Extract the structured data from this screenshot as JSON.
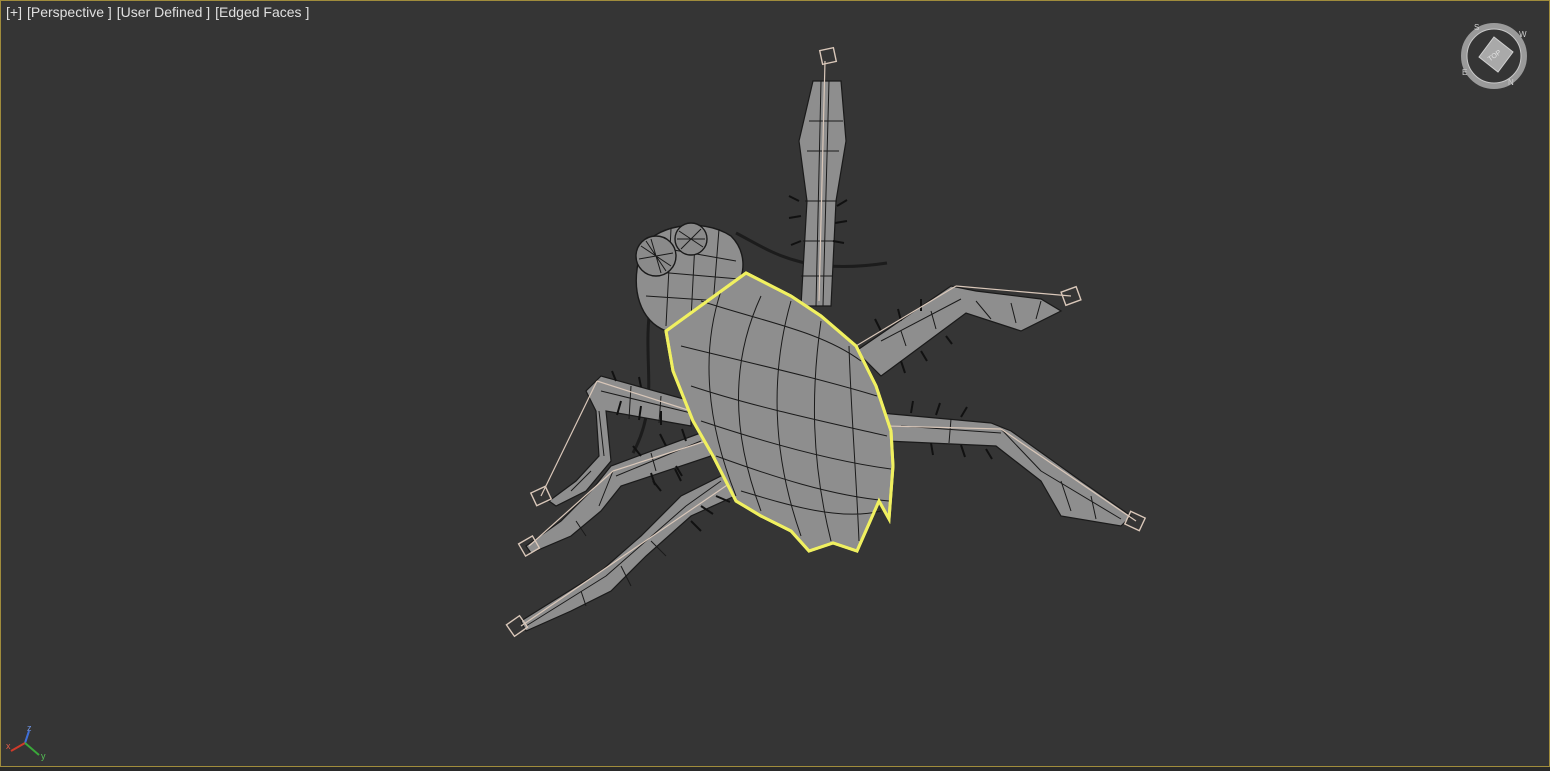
{
  "viewport": {
    "labels": {
      "plus": "[+]",
      "view": "[Perspective ]",
      "shading": "[User Defined ]",
      "edges": "[Edged Faces ]"
    }
  },
  "viewcube": {
    "face_label": "TOP",
    "compass": {
      "north": "N",
      "south": "S",
      "east": "E",
      "west": "W"
    }
  },
  "axis_tripod": {
    "x": "x",
    "y": "y",
    "z": "z"
  },
  "colors": {
    "viewport_bg": "#353535",
    "selection": "#f0f060",
    "mesh_fill": "#8e8e8e",
    "bone": "#d9c7b9",
    "frame": "#a08c3c"
  }
}
